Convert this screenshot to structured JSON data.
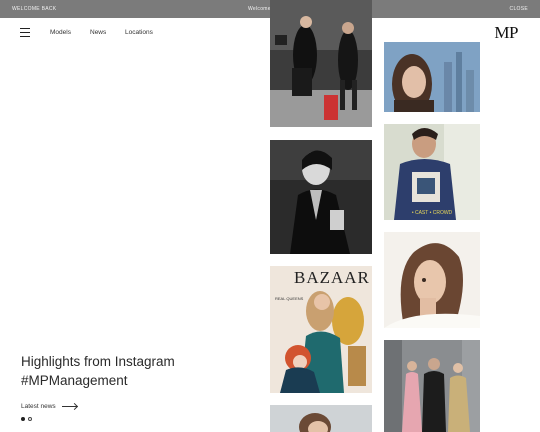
{
  "topbar": {
    "left": "WELCOME BACK",
    "center": "Welcome to our new look website",
    "right": "CLOSE"
  },
  "header": {
    "menu_icon": "hamburger-icon",
    "nav": [
      "Models",
      "News",
      "Locations"
    ],
    "logo": "MP"
  },
  "hero": {
    "headline_line1": "Highlights from Instagram",
    "headline_line2": "#MPManagement",
    "link_label": "Latest news",
    "slides": [
      {
        "active": true
      },
      {
        "active": false
      }
    ]
  },
  "gallery": {
    "cover_title": "BAZAAR",
    "cover_label": "REAL QUEENS",
    "post2_caption": "• CAST • CROWD"
  }
}
